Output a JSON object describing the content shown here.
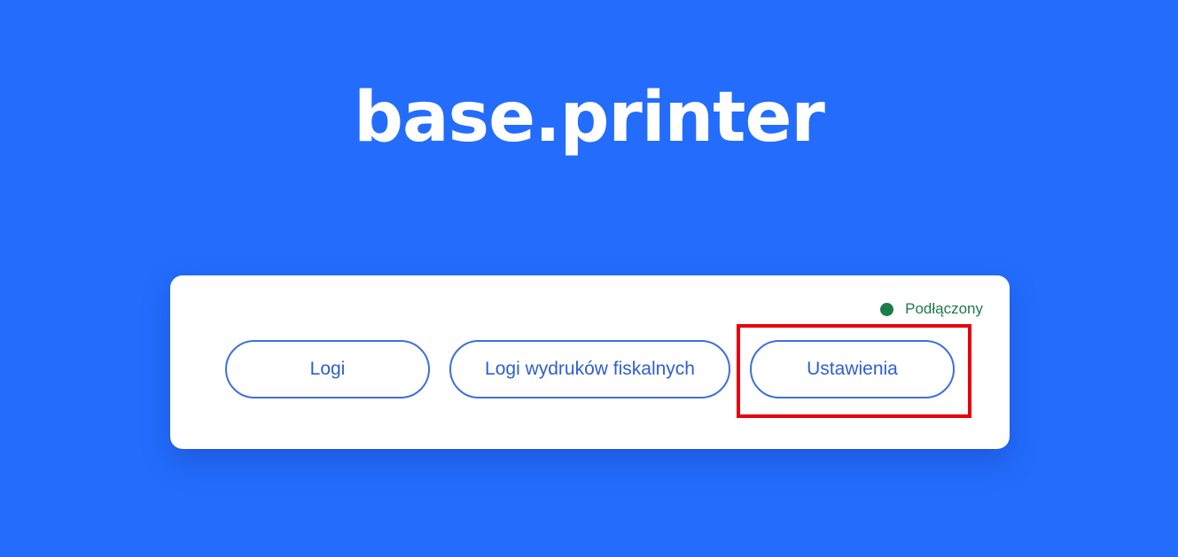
{
  "app": {
    "logo_text": "base.printer"
  },
  "status": {
    "label": "Podłączony",
    "color": "#1c7c4c"
  },
  "buttons": {
    "logs": "Logi",
    "fiscal_logs": "Logi wydruków fiskalnych",
    "settings": "Ustawienia"
  },
  "colors": {
    "background": "#236cfc",
    "button_border": "#3e6fe0",
    "highlight": "#e8000c"
  }
}
